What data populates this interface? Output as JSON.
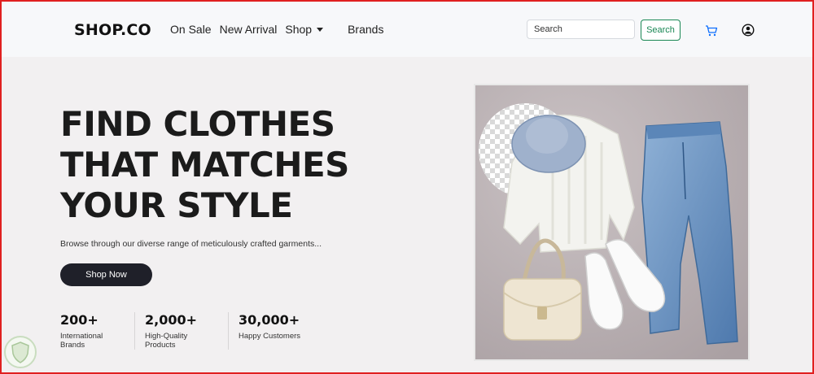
{
  "navbar": {
    "brand": "SHOP.CO",
    "links": [
      "On Sale",
      "New Arrival",
      "Shop",
      "Brands"
    ],
    "search_placeholder": "Search",
    "search_button": "Search",
    "cart_icon": "cart-icon",
    "user_icon": "user-icon"
  },
  "hero": {
    "headline": [
      "FIND CLOTHES",
      "THAT MATCHES",
      "YOUR STYLE"
    ],
    "subtext": "Browse through our diverse range of meticulously crafted garments...",
    "cta": "Shop Now",
    "stats": [
      {
        "value": "200+",
        "label": "International Brands"
      },
      {
        "value": "2,000+",
        "label": "High-Quality Products"
      },
      {
        "value": "30,000+",
        "label": "Happy Customers"
      }
    ]
  },
  "colors": {
    "accent_green": "#198754",
    "cta_dark": "#1f2029",
    "hero_bg": "#f2f0f1",
    "border_red": "#e02020"
  }
}
